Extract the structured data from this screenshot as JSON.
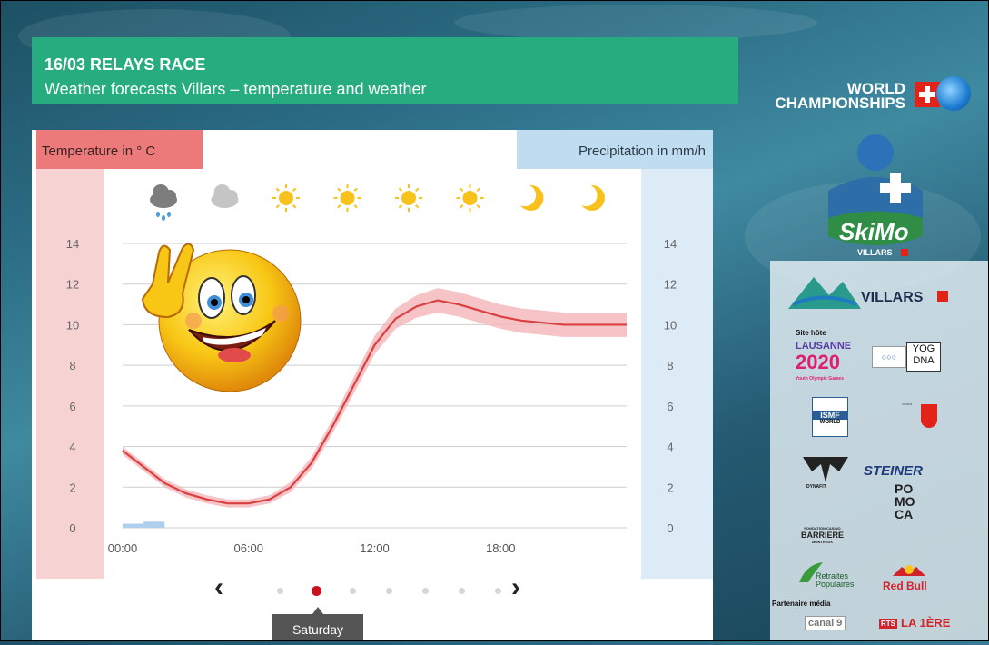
{
  "banner": {
    "title": "16/03 RELAYS RACE",
    "subtitle": "Weather forecasts Villars – temperature and weather"
  },
  "logo_world": {
    "line1": "WORLD",
    "line2": "CHAMPIONSHIPS"
  },
  "chart_data": {
    "type": "line",
    "title": "",
    "left_axis_label": "Temperature in ° C",
    "right_axis_label": "Precipitation in mm/h",
    "y_ticks_left": [
      "14",
      "12",
      "10",
      "8",
      "6",
      "4",
      "2",
      "0"
    ],
    "y_ticks_right": [
      "14",
      "12",
      "10",
      "8",
      "6",
      "4",
      "2",
      "0"
    ],
    "ylim": [
      0,
      14
    ],
    "x_ticks": [
      "00:00",
      "06:00",
      "12:00",
      "18:00"
    ],
    "xlim_hours": [
      0,
      24
    ],
    "weather_icons": [
      "rain-cloud",
      "cloud",
      "sun",
      "sun",
      "sun",
      "sun",
      "moon",
      "moon"
    ],
    "series": [
      {
        "name": "",
        "x": [
          0,
          1,
          2,
          3,
          4,
          5,
          6,
          7,
          8,
          9,
          10,
          11,
          12,
          13,
          14,
          15,
          16,
          17,
          18,
          19,
          20,
          21,
          22,
          23,
          24
        ],
        "values": [
          3.8,
          3.0,
          2.2,
          1.7,
          1.4,
          1.2,
          1.2,
          1.4,
          2.0,
          3.2,
          5.0,
          7.0,
          9.0,
          10.3,
          10.9,
          11.2,
          11.0,
          10.7,
          10.4,
          10.2,
          10.1,
          10.0,
          10.0,
          10.0,
          10.0
        ],
        "band": [
          0.2,
          0.2,
          0.2,
          0.2,
          0.2,
          0.2,
          0.2,
          0.2,
          0.25,
          0.3,
          0.35,
          0.4,
          0.45,
          0.5,
          0.55,
          0.6,
          0.6,
          0.6,
          0.6,
          0.6,
          0.6,
          0.6,
          0.6,
          0.6,
          0.6
        ]
      }
    ],
    "precipitation": {
      "x": [
        0.5,
        1.5
      ],
      "values": [
        0.2,
        0.3
      ]
    }
  },
  "nav": {
    "prev": "‹",
    "next": "›",
    "dots": 7,
    "active_dot": 1,
    "day_label": "Saturday"
  },
  "sponsors": {
    "villars": "VILLARS",
    "site_hote": "Site hôte",
    "lausanne": "LAUSANNE",
    "year": "2020",
    "yog_sub": "Youth Olympic Games",
    "yog": "YOG",
    "dna": "DNA",
    "ismf": "ISMF",
    "ismf_sub": "WORLD",
    "dynafit": "DYNAFIT",
    "steiner": "STEINER",
    "fondation": "FONDATION CASINO",
    "barriere": "BARRIERE",
    "barriere_sub": "MONTREUX",
    "pomoca": "PO MO CA",
    "retraites": "Retraites",
    "populaires": "Populaires",
    "redbull": "Red Bull",
    "partenaire": "Partenaire média",
    "canal9": "canal 9",
    "rts": "RTS",
    "la1ere": "LA 1ÈRE",
    "skimo": "SkiMo",
    "skimo_villars": "VILLARS"
  },
  "colors": {
    "banner": "#27ac7f",
    "temp_line": "#d9403f",
    "temp_band": "#f4b4b8",
    "left_header": "#ec7a7a",
    "right_header": "#bfdcf1",
    "active_dot": "#c5141c"
  }
}
